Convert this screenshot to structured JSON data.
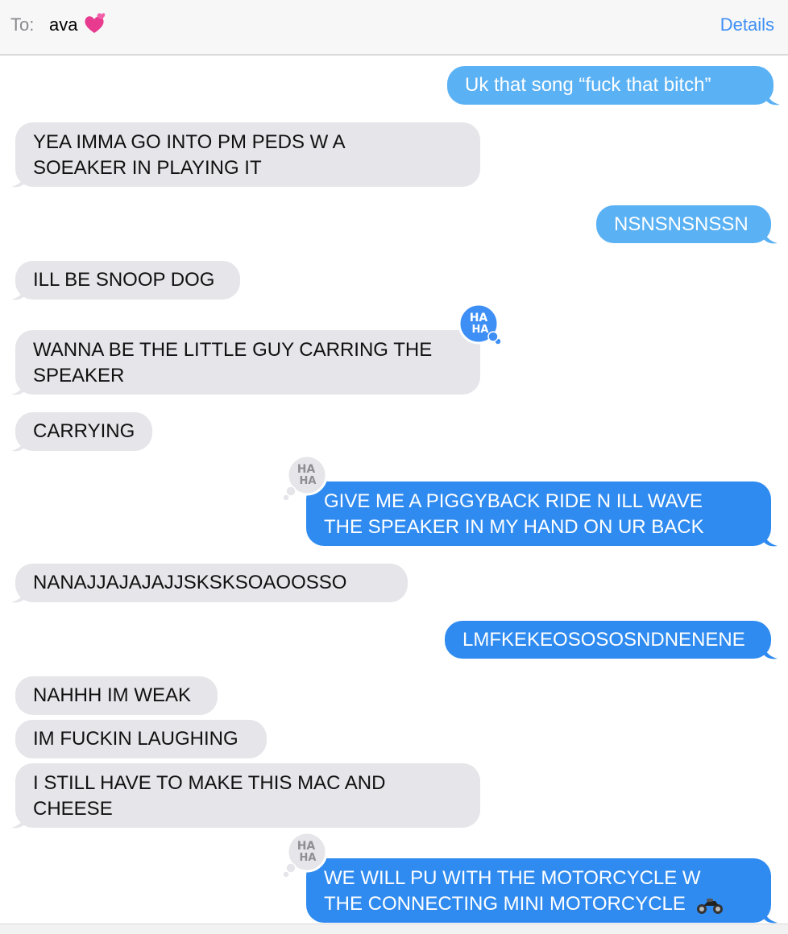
{
  "header": {
    "to_label": "To:",
    "recipient": "ava",
    "recipient_emoji": "two-hearts-icon",
    "details_label": "Details"
  },
  "colors": {
    "received_bubble": "#e5e5ea",
    "sent_bubble": "#2f8bf0",
    "sent_bubble_light": "#5ab1f4",
    "accent": "#3d8ef5"
  },
  "messages": [
    {
      "from": "me",
      "lines": [
        "Uk that song “fuck that bitch”"
      ]
    },
    {
      "from": "them",
      "lines": [
        "YEA IMMA GO INTO PM PEDS W A",
        "SOEAKER IN PLAYING IT"
      ]
    },
    {
      "from": "me",
      "lines": [
        "NSNSNSNSSN"
      ]
    },
    {
      "from": "them",
      "lines": [
        "ILL BE SNOOP DOG"
      ]
    },
    {
      "from": "them",
      "lines": [
        "WANNA BE THE LITTLE GUY CARRING THE",
        "SPEAKER"
      ],
      "tapback": "haha"
    },
    {
      "from": "them",
      "lines": [
        "CARRYING"
      ]
    },
    {
      "from": "me",
      "lines": [
        "GIVE ME A PIGGYBACK RIDE N ILL WAVE",
        "THE SPEAKER IN MY HAND ON UR BACK"
      ],
      "tapback": "haha"
    },
    {
      "from": "them",
      "lines": [
        "NANAJJAJAJAJJSKSKSOAOOSSO"
      ]
    },
    {
      "from": "me",
      "lines": [
        "LMFKEKEOSOSOSNDNENENE"
      ]
    },
    {
      "from": "them",
      "lines": [
        "NAHHH IM WEAK"
      ]
    },
    {
      "from": "them",
      "lines": [
        "IM FUCKIN LAUGHING"
      ]
    },
    {
      "from": "them",
      "lines": [
        "I STILL HAVE TO MAKE THIS MAC AND",
        "CHEESE"
      ]
    },
    {
      "from": "me",
      "lines": [
        "WE WILL PU WITH THE MOTORCYCLE W",
        "THE CONNECTING MINI MOTORCYCLE"
      ],
      "emoji": "motorcycle-icon",
      "tapback": "haha"
    }
  ],
  "tapback_text": "HA HA"
}
